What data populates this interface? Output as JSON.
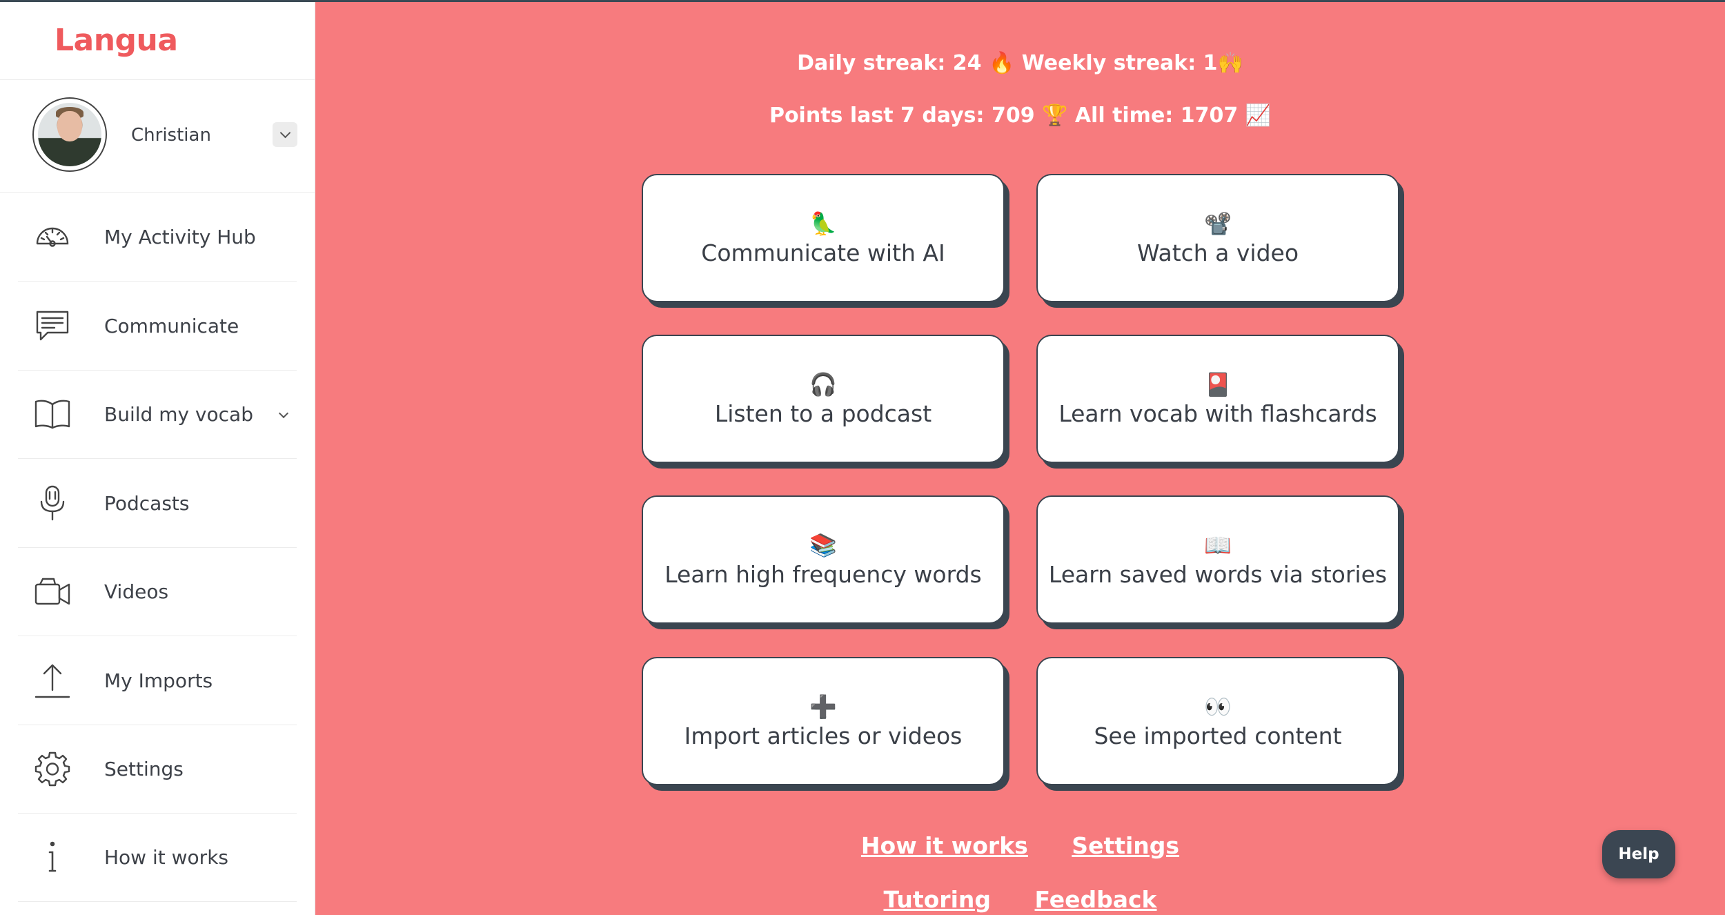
{
  "app": {
    "logo_text": "Langua"
  },
  "user": {
    "name": "Christian"
  },
  "sidebar": {
    "items": [
      {
        "label": "My Activity Hub",
        "icon": "gauge-icon"
      },
      {
        "label": "Communicate",
        "icon": "chat-icon"
      },
      {
        "label": "Build my vocab",
        "icon": "book-icon",
        "has_submenu": true
      },
      {
        "label": "Podcasts",
        "icon": "microphone-icon"
      },
      {
        "label": "Videos",
        "icon": "video-camera-icon"
      },
      {
        "label": "My Imports",
        "icon": "upload-icon"
      },
      {
        "label": "Settings",
        "icon": "gear-icon"
      },
      {
        "label": "How it works",
        "icon": "info-icon"
      }
    ]
  },
  "stats": {
    "line1": "Daily streak: 24 🔥  Weekly streak: 1🙌",
    "line2": "Points last 7 days: 709 🏆  All time: 1707 📈"
  },
  "cards": [
    {
      "emoji": "🦜",
      "title": "Communicate with AI"
    },
    {
      "emoji": "📽️",
      "title": "Watch a video"
    },
    {
      "emoji": "🎧",
      "title": "Listen to a podcast"
    },
    {
      "emoji": "🎴",
      "title": "Learn vocab with flashcards"
    },
    {
      "emoji": "📚",
      "title": "Learn high frequency words"
    },
    {
      "emoji": "📖",
      "title": "Learn saved words via stories"
    },
    {
      "emoji": "➕",
      "title": "Import articles or videos"
    },
    {
      "emoji": "👀",
      "title": "See imported content"
    }
  ],
  "footer_links": {
    "how_it_works": "How it works",
    "settings": "Settings",
    "tutoring": "Tutoring",
    "feedback": "Feedback"
  },
  "help_button": "Help",
  "colors": {
    "background": "#f77b7e",
    "brand": "#ef5a5d",
    "dark": "#3a4550"
  }
}
